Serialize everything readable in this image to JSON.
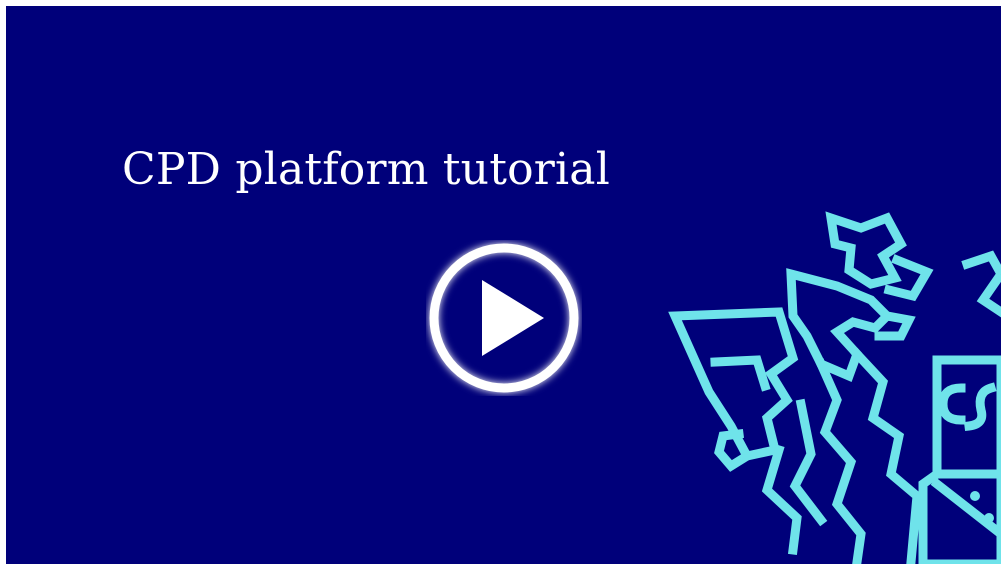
{
  "video": {
    "title": "CPD platform tutorial"
  },
  "colors": {
    "background": "#00007a",
    "crest": "#6fe3ea",
    "text": "#ffffff"
  },
  "icons": {
    "play": "play-icon",
    "crest": "dragon-crest-icon"
  }
}
